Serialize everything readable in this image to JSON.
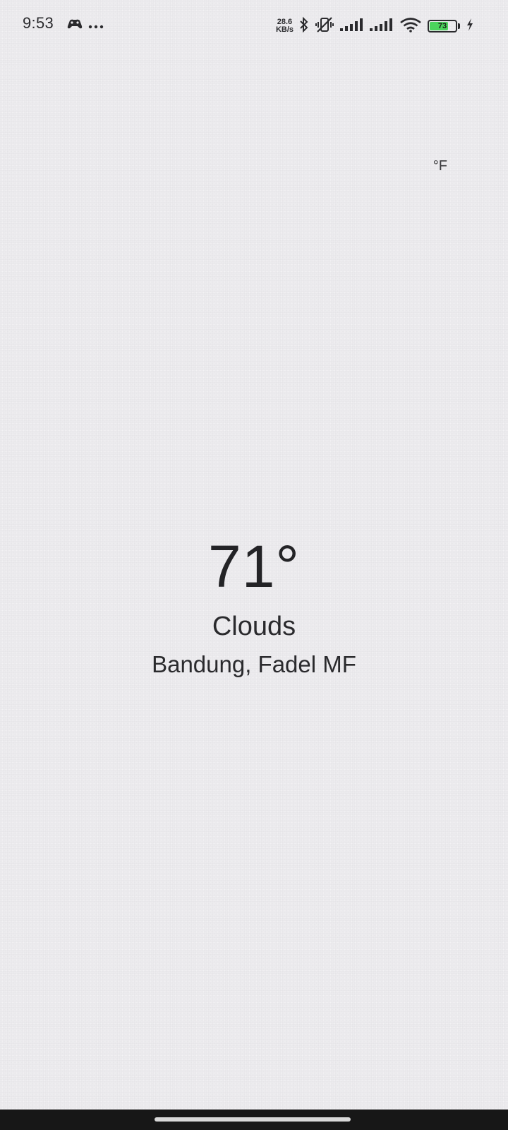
{
  "status_bar": {
    "time": "9:53",
    "net_speed_value": "28.6",
    "net_speed_unit": "KB/s",
    "battery_level": "73",
    "battery_fraction": 0.73,
    "icons": [
      "game-controller-icon",
      "more-dots-icon",
      "bluetooth-icon",
      "vibrate-off-icon",
      "signal-icon",
      "signal-icon",
      "wifi-icon",
      "battery-icon",
      "charging-icon"
    ],
    "battery_color": "#4cd45d"
  },
  "unit_toggle": {
    "label": "°F"
  },
  "weather": {
    "temperature": "71°",
    "condition": "Clouds",
    "location": "Bandung, Fadel MF"
  },
  "colors": {
    "background": "#ecebee",
    "text": "#232326",
    "nav_bar": "#171717"
  }
}
